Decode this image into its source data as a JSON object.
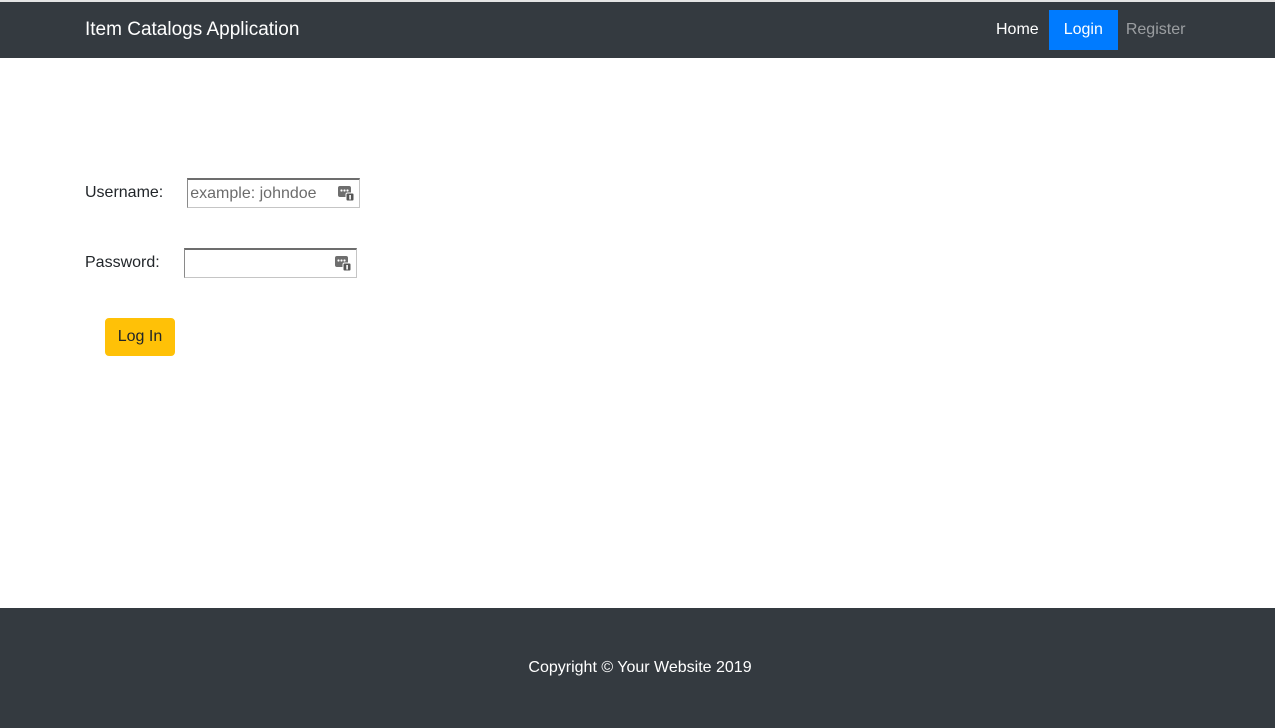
{
  "navbar": {
    "brand": "Item Catalogs Application",
    "links": [
      {
        "label": "Home"
      },
      {
        "label": "Login",
        "active": true
      },
      {
        "label": "Register",
        "muted": true
      }
    ],
    "background_color": "#343a40",
    "active_color": "#007bff"
  },
  "form": {
    "username": {
      "label": "Username:",
      "value": "",
      "placeholder": "example: johndoe"
    },
    "password": {
      "label": "Password:",
      "value": "",
      "placeholder": ""
    },
    "submit_label": "Log In",
    "submit_color": "#ffc107",
    "field_icon": "keychain-autofill-icon"
  },
  "footer": {
    "copyright": "Copyright © Your Website 2019",
    "background_color": "#343a40"
  }
}
